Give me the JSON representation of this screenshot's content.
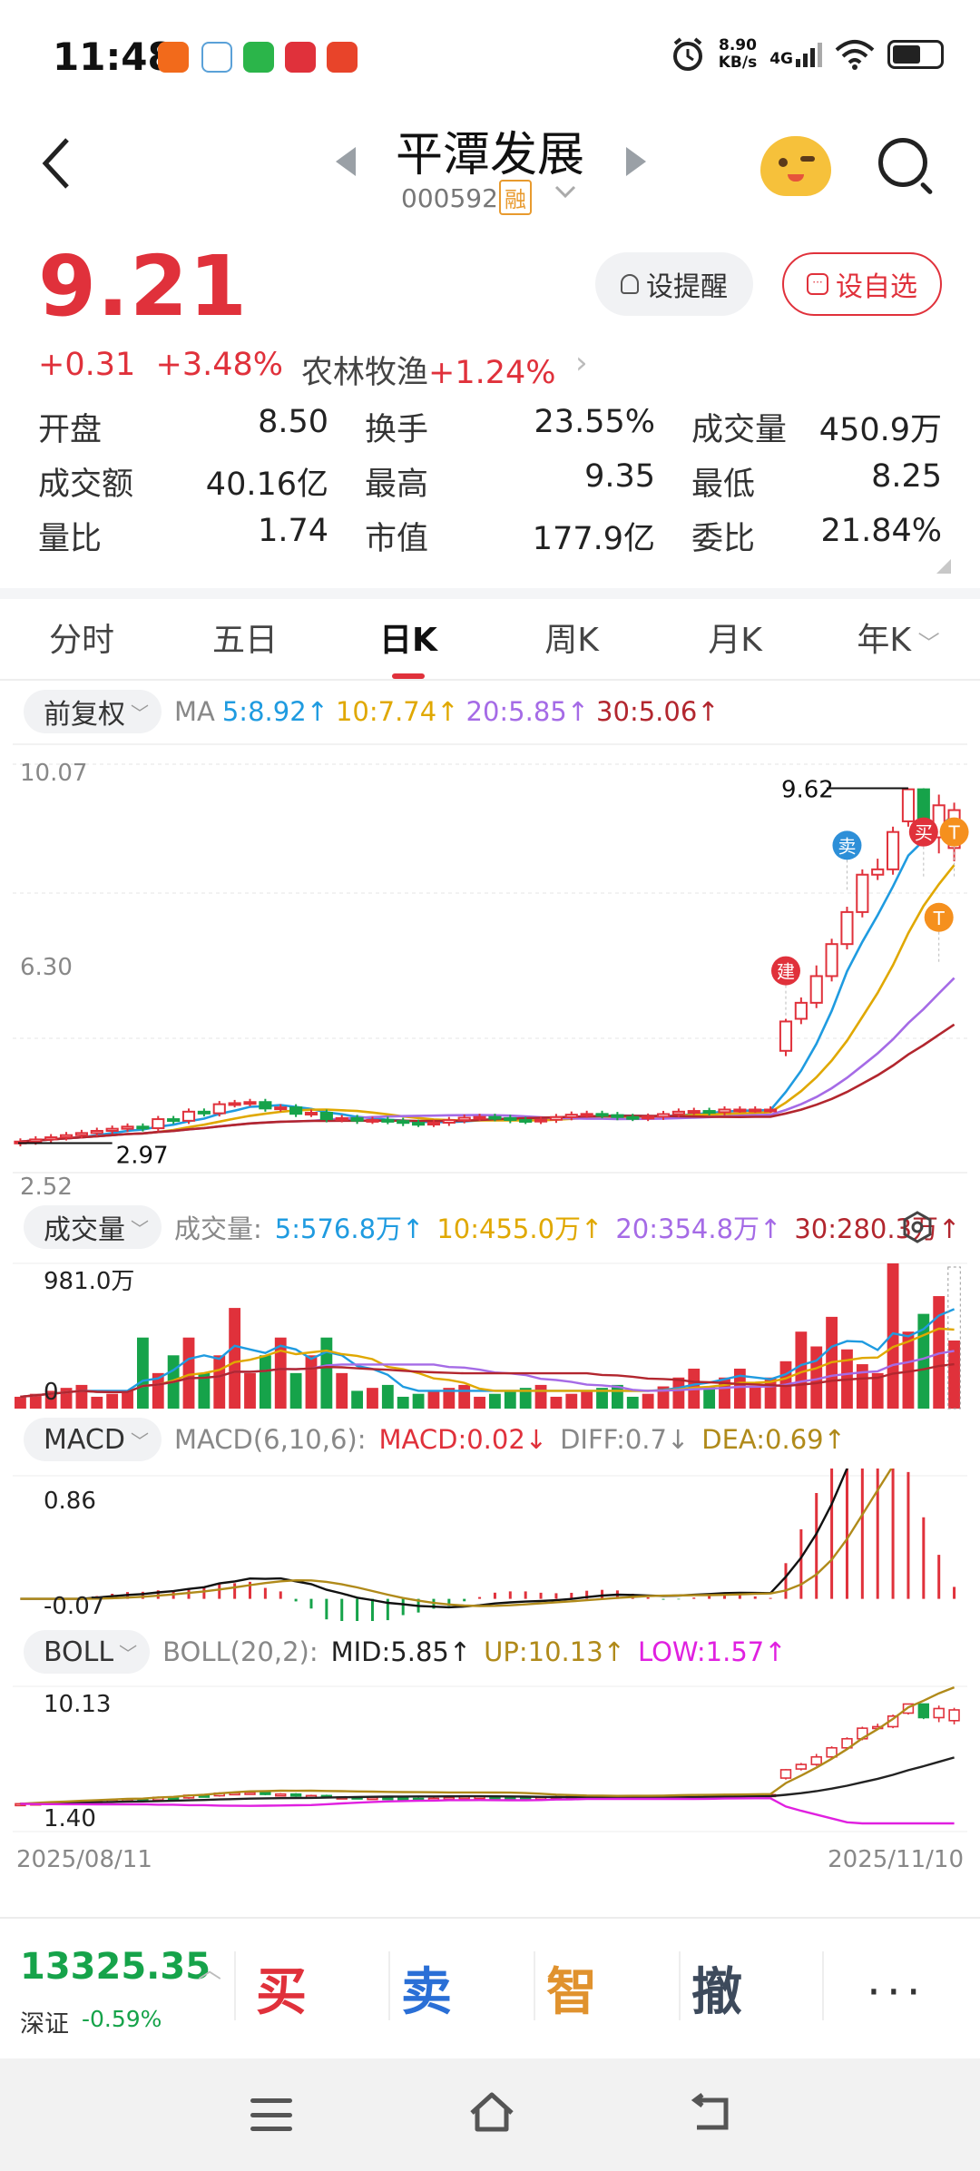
{
  "status_bar": {
    "time": "11:48",
    "net_speed_value": "8.90",
    "net_speed_unit": "KB/s",
    "network": "4G",
    "icons": [
      "alarm-icon",
      "signal-icon",
      "wifi-icon",
      "battery-icon"
    ]
  },
  "nav": {
    "title": "平潭发展",
    "code": "000592",
    "margin_badge": "融"
  },
  "quote": {
    "price": "9.21",
    "change": "+0.31",
    "change_pct": "+3.48%",
    "sector": "农林牧渔",
    "sector_pct": "+1.24%",
    "remind_label": "设提醒",
    "fav_label": "设自选",
    "fields": [
      [
        {
          "k": "开盘",
          "v": "8.50",
          "c": "green"
        },
        {
          "k": "换手",
          "v": "23.55%",
          "c": "black"
        },
        {
          "k": "成交量",
          "v": "450.9万",
          "c": "black"
        }
      ],
      [
        {
          "k": "成交额",
          "v": "40.16亿",
          "c": "black"
        },
        {
          "k": "最高",
          "v": "9.35",
          "c": "red"
        },
        {
          "k": "最低",
          "v": "8.25",
          "c": "green"
        }
      ],
      [
        {
          "k": "量比",
          "v": "1.74",
          "c": "black"
        },
        {
          "k": "市值",
          "v": "177.9亿",
          "c": "black"
        },
        {
          "k": "委比",
          "v": "21.84%",
          "c": "red"
        }
      ]
    ]
  },
  "tabs": [
    "分时",
    "五日",
    "日K",
    "周K",
    "月K",
    "年K"
  ],
  "active_tab": "日K",
  "ma_row": {
    "pill": "前复权",
    "label": "MA",
    "items": [
      "5:8.92↑",
      "10:7.74↑",
      "20:5.85↑",
      "30:5.06↑"
    ],
    "colors": [
      "#1f9be0",
      "#e0a800",
      "#a56be6",
      "#b2262e"
    ]
  },
  "vol_row": {
    "pill": "成交量",
    "label": "成交量:",
    "items": [
      "5:576.8万↑",
      "10:455.0万↑",
      "20:354.8万↑",
      "30:280.3万↑"
    ],
    "colors": [
      "#1f9be0",
      "#e0a800",
      "#a56be6",
      "#b2262e"
    ]
  },
  "macd_row": {
    "pill": "MACD",
    "label": "MACD(6,10,6):",
    "items": [
      "MACD:0.02↓",
      "DIFF:0.7↓",
      "DEA:0.69↑"
    ],
    "colors": [
      "#e0313b",
      "#888888",
      "#b08a1a"
    ]
  },
  "boll_row": {
    "pill": "BOLL",
    "label": "BOLL(20,2):",
    "items": [
      "MID:5.85↑",
      "UP:10.13↑",
      "LOW:1.57↑"
    ],
    "colors": [
      "#222222",
      "#b08a1a",
      "#e020e0"
    ]
  },
  "chart_data": [
    {
      "type": "candlestick",
      "title": "日K",
      "y_axis_labels": [
        "10.07",
        "6.30",
        "2.52"
      ],
      "ylim": [
        2.52,
        10.07
      ],
      "high_marker": "9.62",
      "low_marker": "2.97",
      "signals": [
        "建",
        "卖",
        "买",
        "T",
        "T"
      ],
      "x_range": [
        "2025/08/11",
        "2025/11/10"
      ],
      "candles_tail": [
        {
          "o": 4.7,
          "c": 5.25,
          "h": 5.3,
          "l": 4.6
        },
        {
          "o": 5.3,
          "c": 5.6,
          "h": 5.7,
          "l": 5.2
        },
        {
          "o": 5.6,
          "c": 6.1,
          "h": 6.3,
          "l": 5.5
        },
        {
          "o": 6.1,
          "c": 6.7,
          "h": 6.8,
          "l": 6.0
        },
        {
          "o": 6.7,
          "c": 7.3,
          "h": 7.4,
          "l": 6.6
        },
        {
          "o": 7.3,
          "c": 8.0,
          "h": 8.1,
          "l": 7.2
        },
        {
          "o": 8.0,
          "c": 8.1,
          "h": 8.3,
          "l": 7.9
        },
        {
          "o": 8.1,
          "c": 8.8,
          "h": 8.9,
          "l": 8.0
        },
        {
          "o": 9.0,
          "c": 9.6,
          "h": 9.62,
          "l": 8.9
        },
        {
          "o": 9.6,
          "c": 8.7,
          "h": 9.62,
          "l": 8.6
        },
        {
          "o": 8.7,
          "c": 9.3,
          "h": 9.5,
          "l": 8.4
        },
        {
          "o": 8.5,
          "c": 9.21,
          "h": 9.35,
          "l": 8.25
        }
      ],
      "series": [
        {
          "name": "MA5",
          "last": 8.92
        },
        {
          "name": "MA10",
          "last": 7.74
        },
        {
          "name": "MA20",
          "last": 5.85
        },
        {
          "name": "MA30",
          "last": 5.06
        }
      ]
    },
    {
      "type": "bar",
      "title": "成交量",
      "y_axis_labels": [
        "981.0万",
        "0"
      ],
      "ylim": [
        0,
        981.0
      ],
      "series": [
        {
          "name": "5",
          "last": 576.8
        },
        {
          "name": "10",
          "last": 455.0
        },
        {
          "name": "20",
          "last": 354.8
        },
        {
          "name": "30",
          "last": 280.3
        }
      ]
    },
    {
      "type": "line",
      "title": "MACD(6,10,6)",
      "y_axis_labels": [
        "0.86",
        "-0.07"
      ],
      "ylim": [
        -0.07,
        0.86
      ],
      "series": [
        {
          "name": "MACD",
          "last": 0.02
        },
        {
          "name": "DIFF",
          "last": 0.7
        },
        {
          "name": "DEA",
          "last": 0.69
        }
      ]
    },
    {
      "type": "line",
      "title": "BOLL(20,2)",
      "y_axis_labels": [
        "10.13",
        "1.40"
      ],
      "ylim": [
        1.4,
        10.13
      ],
      "series": [
        {
          "name": "MID",
          "last": 5.85
        },
        {
          "name": "UP",
          "last": 10.13
        },
        {
          "name": "LOW",
          "last": 1.57
        }
      ]
    }
  ],
  "dates": {
    "start": "2025/08/11",
    "end": "2025/11/10"
  },
  "bottom": {
    "index_value": "13325.35",
    "index_name": "深证",
    "index_change": "-0.59%",
    "actions": [
      "买",
      "卖",
      "智",
      "撤"
    ],
    "action_colors": [
      "#e0313b",
      "#2a6fd6",
      "#e0922e",
      "#3d4a5c"
    ],
    "more": "···"
  }
}
